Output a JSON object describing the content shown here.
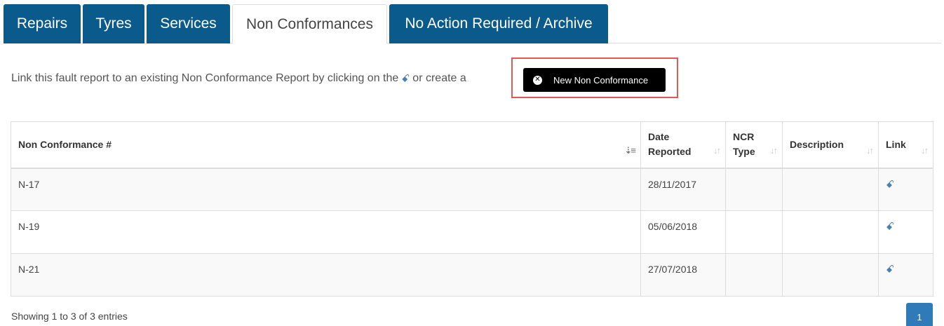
{
  "tabs": [
    {
      "label": "Repairs",
      "active": false
    },
    {
      "label": "Tyres",
      "active": false
    },
    {
      "label": "Services",
      "active": false
    },
    {
      "label": "Non Conformances",
      "active": true
    },
    {
      "label": "No Action Required / Archive",
      "active": false
    }
  ],
  "instruction": {
    "text_before": "Link this fault report to an existing Non Conformance Report by clicking on the",
    "link_glyph": "ꗃ",
    "text_after": "or create a"
  },
  "new_button": {
    "label": "New Non Conformance",
    "icon": "times-circle-icon"
  },
  "table": {
    "headers": {
      "number": "Non Conformance #",
      "date_line1": "Date",
      "date_line2": "Reported",
      "type_line1": "NCR",
      "type_line2": "Type",
      "description": "Description",
      "link": "Link"
    },
    "rows": [
      {
        "number": "N-17",
        "date": "28/11/2017",
        "type": "",
        "description": "",
        "link_icon": "ꗃ"
      },
      {
        "number": "N-19",
        "date": "05/06/2018",
        "type": "",
        "description": "",
        "link_icon": "ꗃ"
      },
      {
        "number": "N-21",
        "date": "27/07/2018",
        "type": "",
        "description": "",
        "link_icon": "ꗃ"
      }
    ]
  },
  "footer": {
    "info": "Showing 1 to 3 of 3 entries",
    "page": "1"
  },
  "colors": {
    "tab_bg": "#0a5a8c",
    "highlight": "#e05a5a",
    "link": "#4a7fb0",
    "pagination": "#2f7ab8"
  }
}
